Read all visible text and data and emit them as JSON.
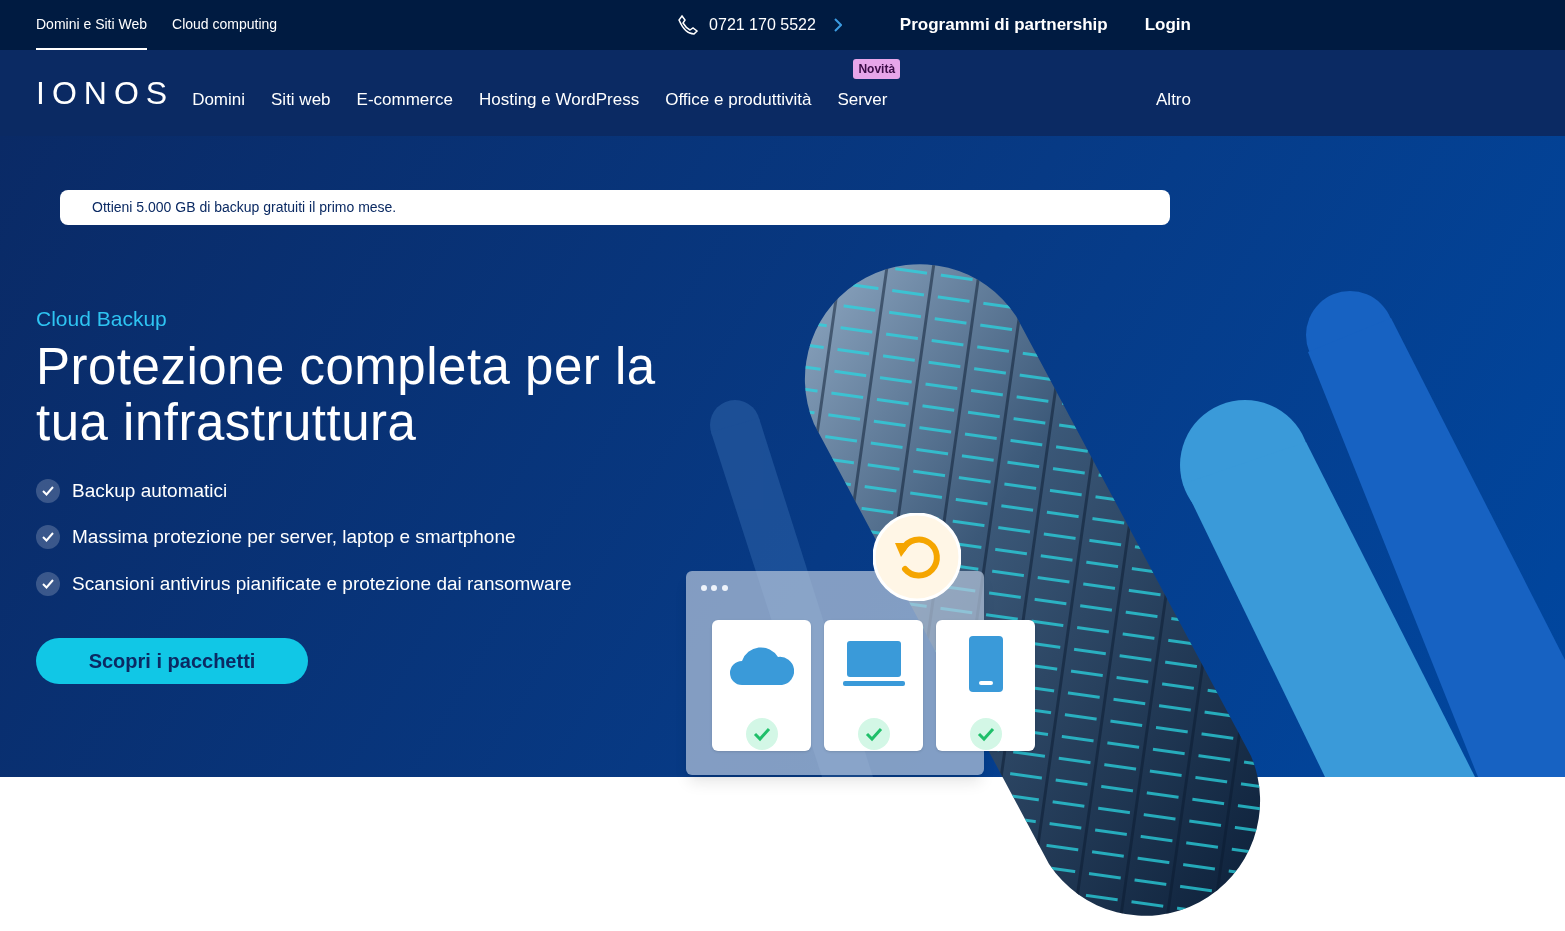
{
  "top_bar": {
    "tabs": [
      {
        "label": "Domini e Siti Web",
        "selected": true
      },
      {
        "label": "Cloud computing",
        "selected": false
      }
    ],
    "phone": "0721 170 5522",
    "links": [
      "Programmi di partnership",
      "Login"
    ]
  },
  "nav": {
    "logo": "IONOS",
    "items": [
      {
        "label": "Domini"
      },
      {
        "label": "Siti web"
      },
      {
        "label": "E-commerce"
      },
      {
        "label": "Hosting e WordPress"
      },
      {
        "label": "Office e produttività"
      },
      {
        "label": "Server",
        "badge": "Novità"
      }
    ],
    "more": "Altro"
  },
  "hero": {
    "banner": "Ottieni 5.000 GB di backup gratuiti il primo mese.",
    "eyebrow": "Cloud Backup",
    "title": "Protezione completa per la tua infrastruttura",
    "features": [
      "Backup automatici",
      "Massima protezione per server, laptop e smartphone",
      "Scansioni antivirus pianificate e protezione dai ransomware"
    ],
    "cta": "Scopri i pacchetti",
    "devices": [
      {
        "kind": "cloud",
        "done": true
      },
      {
        "kind": "laptop",
        "done": true
      },
      {
        "kind": "phone",
        "done": true
      }
    ]
  }
}
